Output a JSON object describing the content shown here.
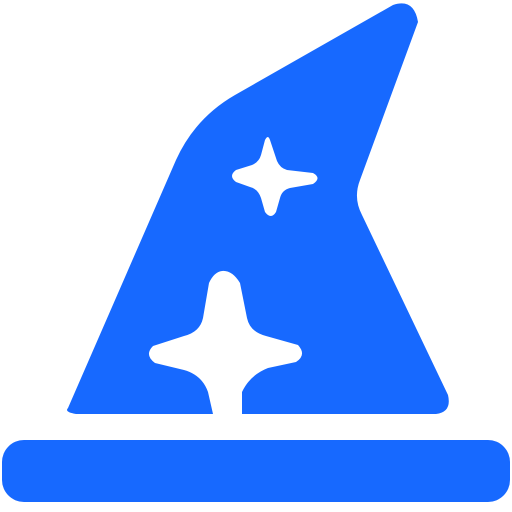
{
  "icon": {
    "name": "wizard-hat-icon",
    "color": "#1769FF",
    "background": "#FFFFFF"
  }
}
